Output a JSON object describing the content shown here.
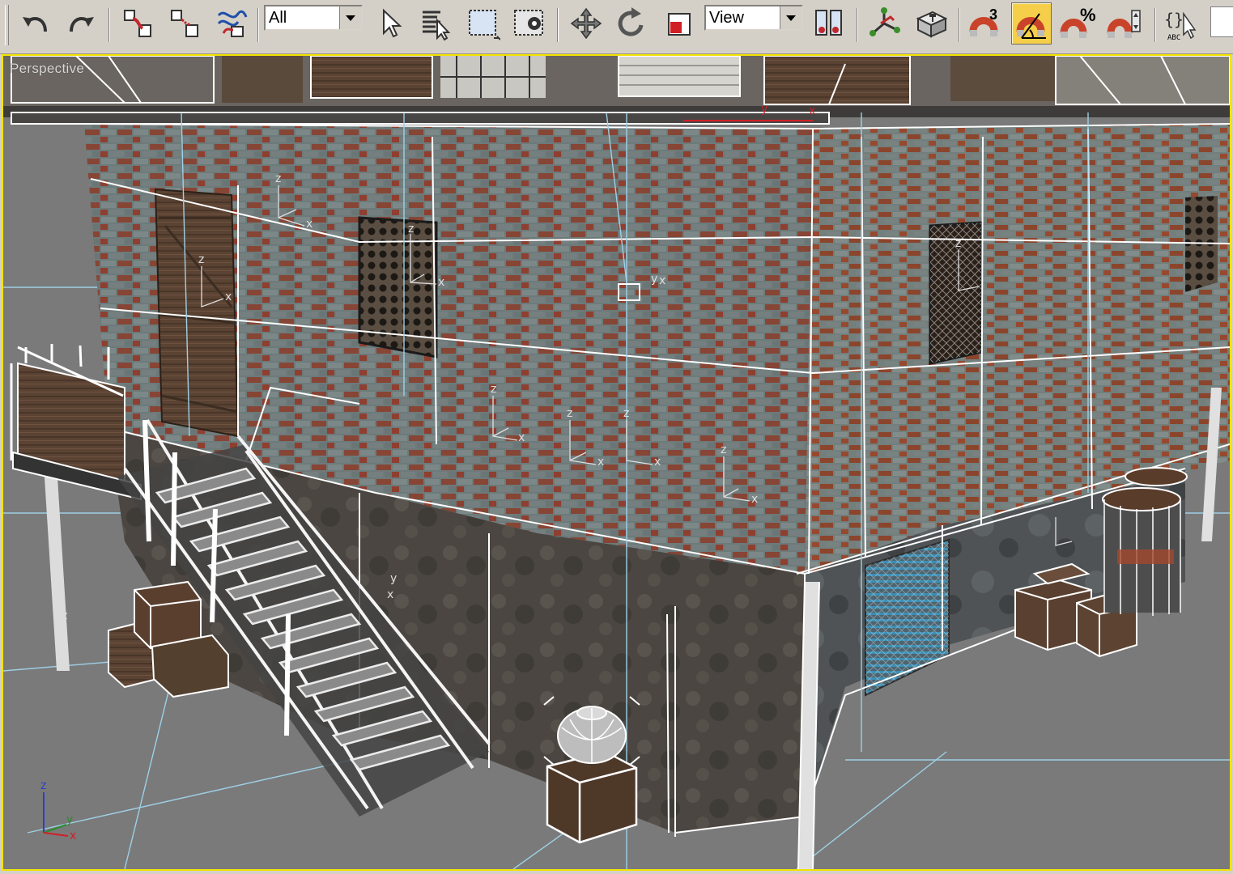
{
  "toolbar": {
    "selection_filter": {
      "value": "All"
    },
    "ref_coord_system": {
      "value": "View"
    },
    "angle_snap_superscript": "3",
    "percent_snap_superscript": "%",
    "named_selection_label": "ABC",
    "icons": [
      "undo-icon",
      "redo-icon",
      "select-and-link-icon",
      "unlink-selection-icon",
      "bind-to-space-warp-icon",
      "select-object-icon",
      "select-by-name-icon",
      "rectangular-selection-region-icon",
      "window-crossing-icon",
      "select-and-move-icon",
      "select-and-rotate-icon",
      "select-and-scale-icon",
      "use-pivot-center-icon",
      "select-and-manipulate-icon",
      "keyboard-shortcut-override-icon",
      "snaps-toggle-icon",
      "angle-snap-icon",
      "percent-snap-icon",
      "spinner-snap-icon",
      "edit-named-selection-icon"
    ],
    "active_tool": "angle-snap-icon",
    "accent_color": "#f6cf4a"
  },
  "viewport": {
    "label": "Perspective",
    "border_color": "#f2e400",
    "background_color": "#7a7a7a",
    "axis_labels": {
      "x": "x",
      "y": "y",
      "z": "z"
    },
    "gizmo_labels": {
      "x": "x",
      "y": "y",
      "z": "z"
    }
  }
}
